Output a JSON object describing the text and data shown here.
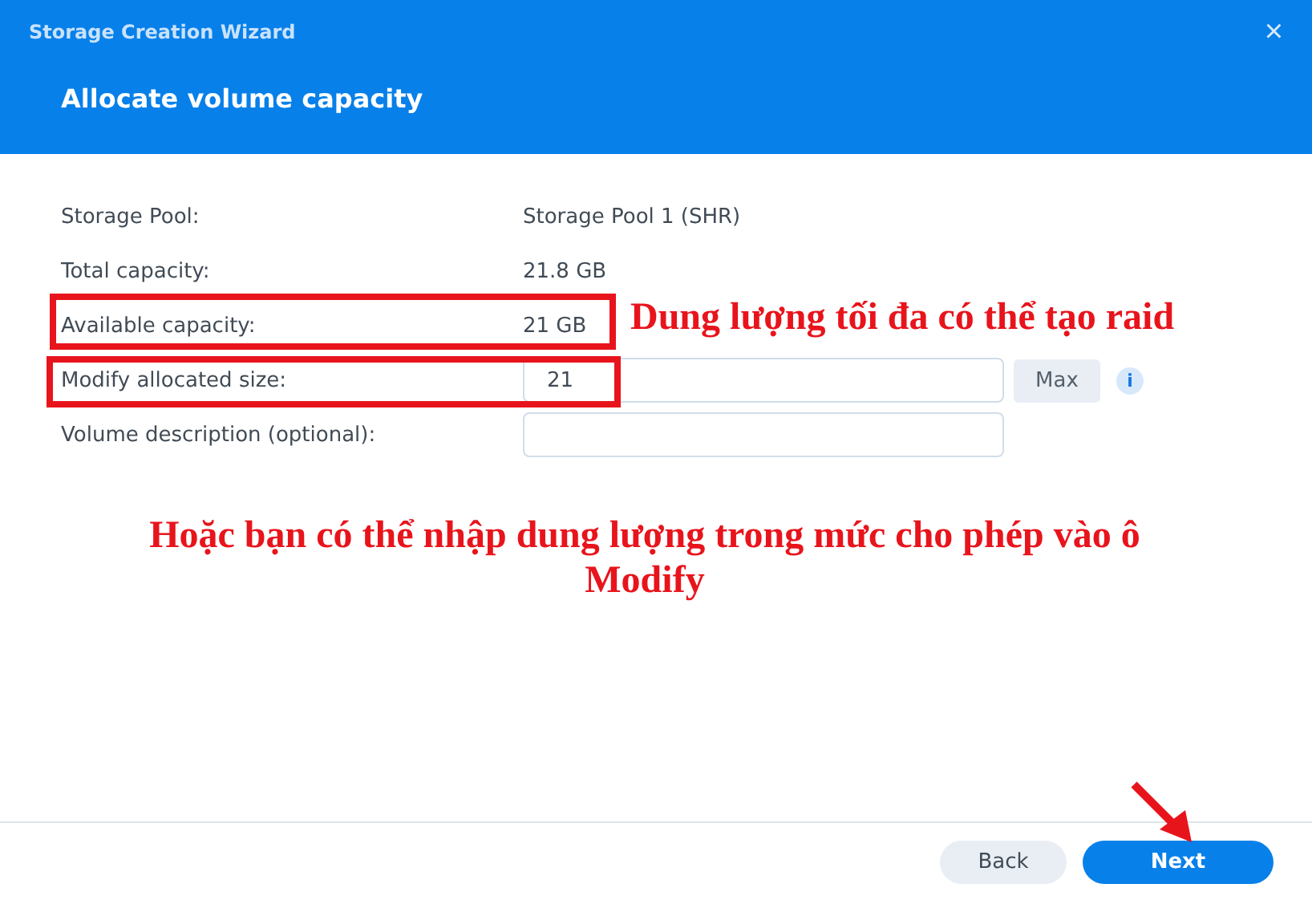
{
  "window": {
    "title": "Storage Creation Wizard",
    "close": "×"
  },
  "heading": "Allocate volume capacity",
  "fields": [
    {
      "kind": "text",
      "label": "Storage Pool:",
      "value": "Storage Pool 1 (SHR)"
    },
    {
      "kind": "text",
      "label": "Total capacity:",
      "value": "21.8 GB"
    },
    {
      "kind": "text",
      "label": "Available capacity:",
      "value": "21 GB"
    },
    {
      "kind": "input",
      "label": "Modify allocated size:",
      "value": "21",
      "button": "Max",
      "info": "i"
    },
    {
      "kind": "input",
      "label": "Volume description (optional):"
    }
  ],
  "annotations": [
    "Dung lượng tối đa có thể tạo raid",
    "Hoặc bạn có thể nhập dung lượng trong mức cho phép vào ô Modify"
  ],
  "buttons": [
    {
      "label": "Back",
      "kind": "secondary"
    },
    {
      "label": "Next",
      "kind": "primary"
    }
  ]
}
